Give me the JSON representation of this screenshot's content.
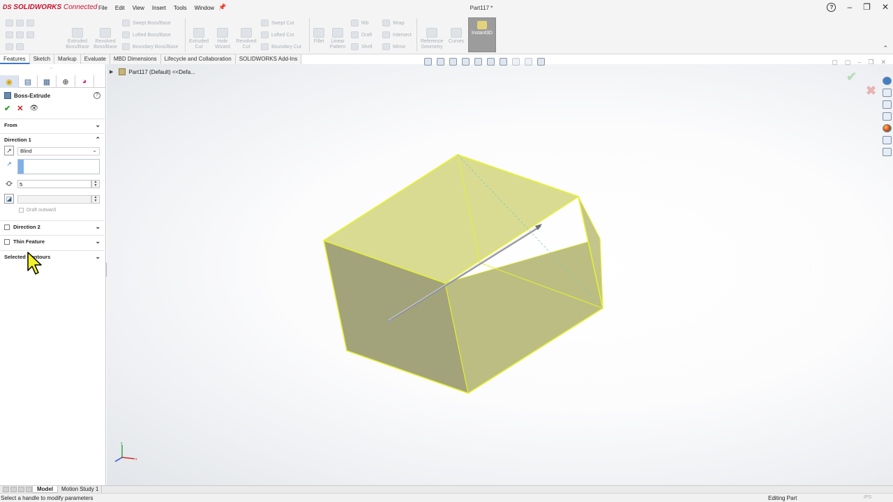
{
  "app": {
    "brand_prefix": "DS",
    "brand_name": "SOLIDWORKS",
    "brand_suffix": "Connected"
  },
  "menus": [
    "File",
    "Edit",
    "View",
    "Insert",
    "Tools",
    "Window"
  ],
  "document": {
    "title": "Part117 *"
  },
  "ribbon": {
    "extruded_boss": "Extruded Boss/Base",
    "revolved_boss": "Revolved Boss/Base",
    "swept_boss": "Swept Boss/Base",
    "lofted_boss": "Lofted Boss/Base",
    "boundary_boss": "Boundary Boss/Base",
    "extruded_cut": "Extruded Cut",
    "hole_wizard": "Hole Wizard",
    "revolved_cut": "Revolved Cut",
    "swept_cut": "Swept Cut",
    "lofted_cut": "Lofted Cut",
    "boundary_cut": "Boundary Cut",
    "fillet": "Fillet",
    "linear_pattern": "Linear Pattern",
    "rib": "Rib",
    "draft": "Draft",
    "shell": "Shell",
    "wrap": "Wrap",
    "intersect": "Intersect",
    "mirror": "Mirror",
    "reference_geometry": "Reference Geometry",
    "curves": "Curves",
    "instant3d": "Instant3D"
  },
  "tabs": [
    "Features",
    "Sketch",
    "Markup",
    "Evaluate",
    "MBD Dimensions",
    "Lifecycle and Collaboration",
    "SOLIDWORKS Add-Ins"
  ],
  "property_manager": {
    "title": "Boss-Extrude",
    "help": "?",
    "from_label": "From",
    "direction1_label": "Direction 1",
    "end_condition": "Blind",
    "depth_value": "5",
    "draft_outward_label": "Draft outward",
    "direction2_label": "Direction 2",
    "thin_feature_label": "Thin Feature",
    "selected_contours_label": "Selected Contours"
  },
  "feature_tree": {
    "root_label": "Part117 (Default) <<Defa..."
  },
  "bottom_tabs": {
    "model": "Model",
    "motion_study": "Motion Study 1"
  },
  "status": {
    "message": "Select a handle to modify parameters",
    "mode": "Editing Part",
    "units": "IPS"
  },
  "colors": {
    "accent": "#3e77c8",
    "brand": "#c8102e",
    "body_fill": "#bcbc7c",
    "edge_highlight": "#e6f032"
  }
}
